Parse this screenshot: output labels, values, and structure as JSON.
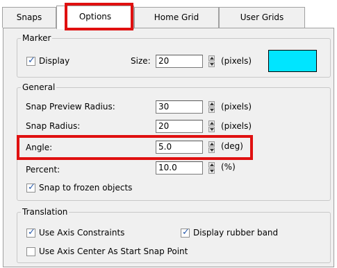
{
  "tabs": [
    {
      "label": "Snaps",
      "active": false
    },
    {
      "label": "Options",
      "active": true
    },
    {
      "label": "Home Grid",
      "active": false
    },
    {
      "label": "User Grids",
      "active": false
    }
  ],
  "marker": {
    "legend": "Marker",
    "display_label": "Display",
    "display_checked": true,
    "size_label": "Size:",
    "size_value": "20",
    "size_unit": "(pixels)",
    "color": "#00e5ff"
  },
  "general": {
    "legend": "General",
    "rows": [
      {
        "label": "Snap Preview Radius:",
        "value": "30",
        "unit": "(pixels)"
      },
      {
        "label": "Snap Radius:",
        "value": "20",
        "unit": "(pixels)"
      },
      {
        "label": "Angle:",
        "value": "5.0",
        "unit": "(deg)"
      },
      {
        "label": "Percent:",
        "value": "10.0",
        "unit": "(%)"
      }
    ],
    "snap_frozen_label": "Snap to frozen objects",
    "snap_frozen_checked": true
  },
  "translation": {
    "legend": "Translation",
    "use_axis_constraints_label": "Use Axis Constraints",
    "use_axis_constraints_checked": true,
    "display_rubber_band_label": "Display rubber band",
    "display_rubber_band_checked": true,
    "axis_center_label": "Use Axis Center As Start Snap Point",
    "axis_center_checked": false
  },
  "highlight_color": "#e01010"
}
